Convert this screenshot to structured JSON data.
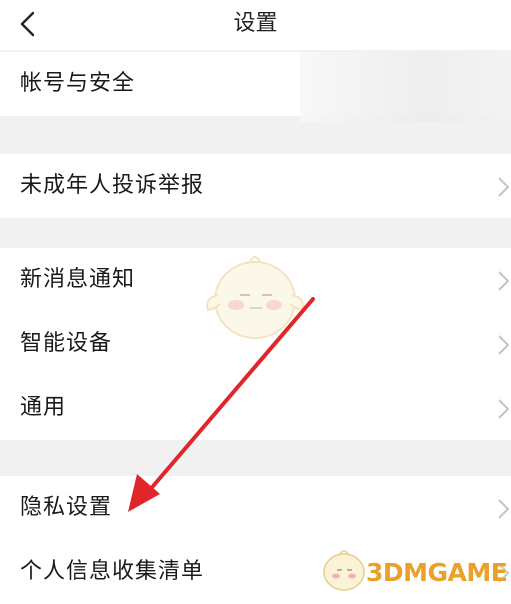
{
  "header": {
    "title": "设置",
    "back_icon": "chevron-left-icon"
  },
  "groups": [
    {
      "items": [
        {
          "label": "帐号与安全",
          "has_chevron": false
        }
      ]
    },
    {
      "items": [
        {
          "label": "未成年人投诉举报",
          "has_chevron": true
        }
      ]
    },
    {
      "items": [
        {
          "label": "新消息通知",
          "has_chevron": true
        },
        {
          "label": "智能设备",
          "has_chevron": true
        },
        {
          "label": "通用",
          "has_chevron": true
        }
      ]
    },
    {
      "items": [
        {
          "label": "隐私设置",
          "has_chevron": true
        },
        {
          "label": "个人信息收集清单",
          "has_chevron": true
        }
      ]
    }
  ],
  "annotation": {
    "arrow_color": "#e0262b",
    "points_to": "隐私设置"
  },
  "watermark": {
    "text": "3DMGAME",
    "color": "#e9a12a"
  },
  "colors": {
    "background": "#f1f1f1",
    "row": "#ffffff",
    "chevron": "#c4c4c4"
  }
}
